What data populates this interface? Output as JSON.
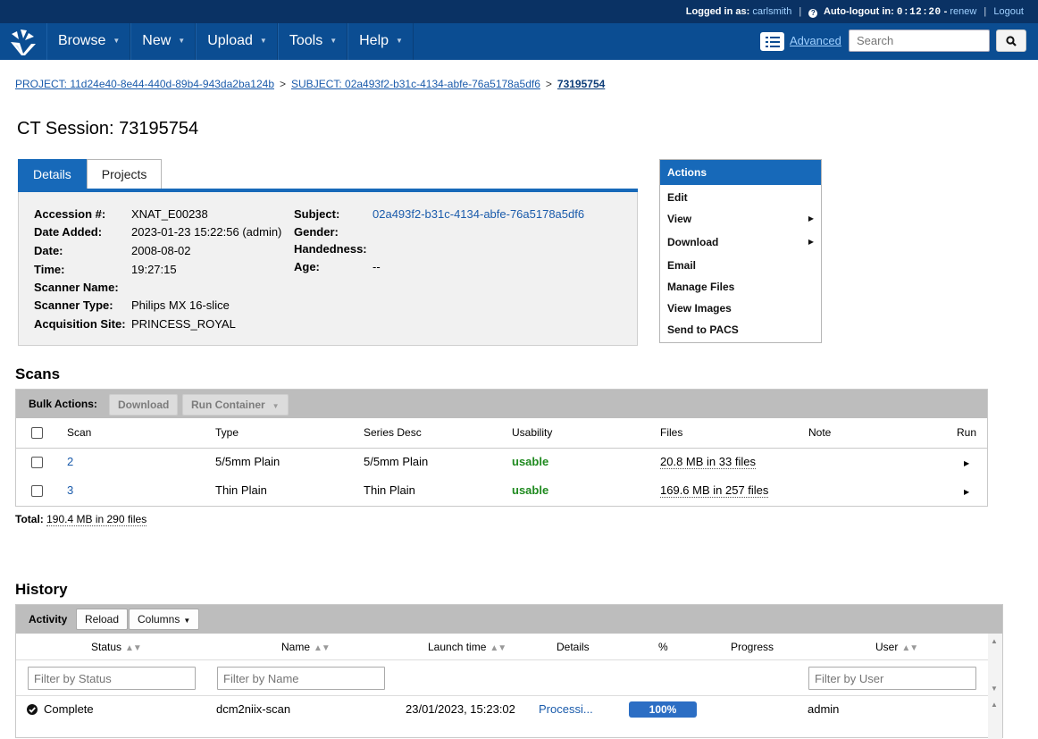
{
  "topbar": {
    "logged_in_label": "Logged in as:",
    "username": "carlsmith",
    "autologout_label": "Auto-logout in:",
    "autologout_time": "0:12:20",
    "renew": "renew",
    "logout": "Logout"
  },
  "nav": {
    "menus": [
      "Browse",
      "New",
      "Upload",
      "Tools",
      "Help"
    ],
    "advanced": "Advanced",
    "search_placeholder": "Search"
  },
  "breadcrumb": {
    "project": "PROJECT: 11d24e40-8e44-440d-89b4-943da2ba124b",
    "subject": "SUBJECT: 02a493f2-b31c-4134-abfe-76a5178a5df6",
    "current": "73195754",
    "separator": ">"
  },
  "page_title": "CT Session: 73195754",
  "tabs": [
    "Details",
    "Projects"
  ],
  "details": {
    "left": [
      {
        "label": "Accession #:",
        "value": "XNAT_E00238"
      },
      {
        "label": "Date Added:",
        "value": "2023-01-23 15:22:56 (admin)"
      },
      {
        "label": "Date:",
        "value": "2008-08-02"
      },
      {
        "label": "Time:",
        "value": "19:27:15"
      },
      {
        "label": "Scanner Name:",
        "value": ""
      },
      {
        "label": "Scanner Type:",
        "value": "Philips MX 16-slice"
      },
      {
        "label": "Acquisition Site:",
        "value": "PRINCESS_ROYAL"
      }
    ],
    "right": [
      {
        "label": "Subject:",
        "value": "02a493f2-b31c-4134-abfe-76a5178a5df6"
      },
      {
        "label": "Gender:",
        "value": ""
      },
      {
        "label": "Handedness:",
        "value": ""
      },
      {
        "label": "Age:",
        "value": "--"
      }
    ]
  },
  "actions": {
    "title": "Actions",
    "items": [
      "Edit",
      "View",
      "Download",
      "Email",
      "Manage Files",
      "View Images",
      "Send to PACS"
    ]
  },
  "scans": {
    "title": "Scans",
    "bulk_label": "Bulk Actions:",
    "download": "Download",
    "run_container": "Run Container",
    "columns": [
      "Scan",
      "Type",
      "Series Desc",
      "Usability",
      "Files",
      "Note",
      "Run"
    ],
    "rows": [
      {
        "scan": "2",
        "type": "5/5mm Plain",
        "series": "5/5mm Plain",
        "usability": "usable",
        "files": "20.8 MB in 33 files",
        "note": ""
      },
      {
        "scan": "3",
        "type": "Thin Plain",
        "series": "Thin Plain",
        "usability": "usable",
        "files": "169.6 MB in 257 files",
        "note": ""
      }
    ],
    "total_label": "Total:",
    "total_value": "190.4 MB in 290 files"
  },
  "history": {
    "title": "History",
    "activity": "Activity",
    "reload": "Reload",
    "columns_btn": "Columns",
    "columns": [
      "Status",
      "Name",
      "Launch time",
      "Details",
      "%",
      "Progress",
      "User"
    ],
    "filter_status": "Filter by Status",
    "filter_name": "Filter by Name",
    "filter_user": "Filter by User",
    "rows": [
      {
        "status": "Complete",
        "name": "dcm2niix-scan",
        "launch": "23/01/2023, 15:23:02",
        "details": "Processi...",
        "percent": "100%",
        "user": "admin"
      }
    ]
  },
  "colors": {
    "topbar": "#0a3264",
    "navbar": "#0b4d92",
    "accent": "#1769b9",
    "usable": "#1f8a1f",
    "progress": "#2c6ec4"
  }
}
